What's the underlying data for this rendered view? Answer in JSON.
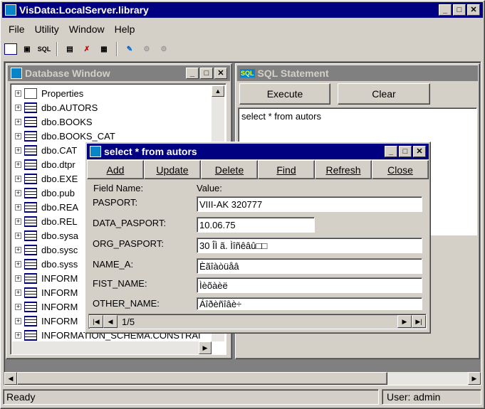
{
  "app": {
    "title": "VisData:LocalServer.library"
  },
  "menu": {
    "file": "File",
    "utility": "Utility",
    "window": "Window",
    "help": "Help"
  },
  "toolbar": {
    "sql_icon_text": "SQL"
  },
  "db_window": {
    "title": "Database Window",
    "items": [
      {
        "label": "Properties",
        "icon": "properties-icon"
      },
      {
        "label": "dbo.AUTORS",
        "icon": "table-icon"
      },
      {
        "label": "dbo.BOOKS",
        "icon": "table-icon"
      },
      {
        "label": "dbo.BOOKS_CAT",
        "icon": "table-icon"
      },
      {
        "label": "dbo.CAT",
        "icon": "table-icon"
      },
      {
        "label": "dbo.dtpr",
        "icon": "table-icon"
      },
      {
        "label": "dbo.EXE",
        "icon": "table-icon"
      },
      {
        "label": "dbo.pub",
        "icon": "table-icon"
      },
      {
        "label": "dbo.REA",
        "icon": "table-icon"
      },
      {
        "label": "dbo.REL",
        "icon": "table-icon"
      },
      {
        "label": "dbo.sysa",
        "icon": "table-icon"
      },
      {
        "label": "dbo.sysc",
        "icon": "table-icon"
      },
      {
        "label": "dbo.syss",
        "icon": "table-icon"
      },
      {
        "label": "INFORM",
        "icon": "table-icon"
      },
      {
        "label": "INFORM",
        "icon": "table-icon"
      },
      {
        "label": "INFORM",
        "icon": "table-icon"
      },
      {
        "label": "INFORM",
        "icon": "table-icon"
      },
      {
        "label": "INFORMATION_SCHEMA.CONSTRAI",
        "icon": "table-icon"
      }
    ]
  },
  "sql_window": {
    "title": "SQL Statement",
    "icon_text": "SQL",
    "execute": "Execute",
    "clear": "Clear",
    "query": "select * from autors"
  },
  "record_window": {
    "title": "select * from autors",
    "buttons": {
      "add": "Add",
      "update": "Update",
      "delete": "Delete",
      "find": "Find",
      "refresh": "Refresh",
      "close": "Close"
    },
    "col_field": "Field Name:",
    "col_value": "Value:",
    "fields": [
      {
        "name": "PASPORT:",
        "value": "VIII-AK 320777"
      },
      {
        "name": "DATA_PASPORT:",
        "value": "10.06.75"
      },
      {
        "name": "ORG_PASPORT:",
        "value": "30 ÎÌ ã. Ìîñêâû□□"
      },
      {
        "name": "NAME_A:",
        "value": "Èãîàòüåâ"
      },
      {
        "name": "FIST_NAME:",
        "value": "Ìèõàèë"
      },
      {
        "name": "OTHER_NAME:",
        "value": "Áîðèñîâè÷"
      }
    ],
    "position": "1/5"
  },
  "status": {
    "ready": "Ready",
    "user": "User: admin"
  },
  "colors": {
    "active_title": "#000080",
    "inactive_title": "#808080",
    "face": "#d4d0c8"
  }
}
